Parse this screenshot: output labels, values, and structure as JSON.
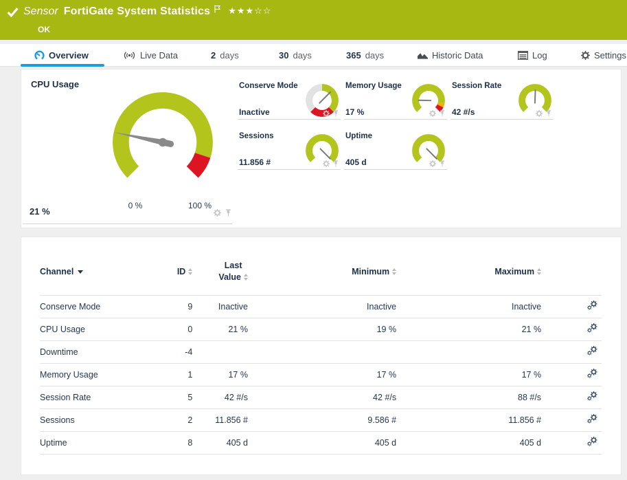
{
  "header": {
    "sensor_label": "Sensor",
    "title": "FortiGate System Statistics",
    "status": "OK",
    "stars": "★★★☆☆",
    "priority_stars_filled": 3,
    "priority_stars_total": 5
  },
  "tabs": [
    {
      "label": "Overview",
      "icon": "gauge-icon",
      "active": true
    },
    {
      "label": "Live Data",
      "icon": "live-data-icon",
      "active": false
    },
    {
      "prefix": "2",
      "suffix": "days",
      "active": false
    },
    {
      "prefix": "30",
      "suffix": "days",
      "active": false
    },
    {
      "prefix": "365",
      "suffix": "days",
      "active": false
    },
    {
      "label": "Historic Data",
      "icon": "historic-data-icon",
      "active": false
    },
    {
      "label": "Log",
      "icon": "log-icon",
      "active": false
    },
    {
      "label": "Settings",
      "icon": "gear-icon",
      "active": false
    }
  ],
  "gauges": {
    "cpu": {
      "title": "CPU Usage",
      "value": "21 %",
      "min_label": "0 %",
      "max_label": "100 %"
    },
    "mini": [
      {
        "title": "Conserve Mode",
        "value": "Inactive"
      },
      {
        "title": "Memory Usage",
        "value": "17 %"
      },
      {
        "title": "Session Rate",
        "value": "42 #/s"
      },
      {
        "title": "Sessions",
        "value": "11.856 #"
      },
      {
        "title": "Uptime",
        "value": "405 d"
      }
    ]
  },
  "chart_data": [
    {
      "type": "gauge",
      "title": "CPU Usage",
      "value": 21,
      "unit": "%",
      "min": 0,
      "max": 100,
      "segments": [
        {
          "from": 0,
          "to": 90,
          "color": "#b3c41c"
        },
        {
          "from": 90,
          "to": 100,
          "color": "#dd1522"
        }
      ]
    },
    {
      "type": "gauge",
      "title": "Conserve Mode",
      "value": "Inactive"
    },
    {
      "type": "gauge",
      "title": "Memory Usage",
      "value": 17,
      "unit": "%"
    },
    {
      "type": "gauge",
      "title": "Session Rate",
      "value": 42,
      "unit": "#/s"
    },
    {
      "type": "gauge",
      "title": "Sessions",
      "value": 11856,
      "unit": "#"
    },
    {
      "type": "gauge",
      "title": "Uptime",
      "value": 405,
      "unit": "d"
    }
  ],
  "table": {
    "header": {
      "channel": "Channel",
      "id": "ID",
      "last1": "Last",
      "last2": "Value",
      "min": "Minimum",
      "max": "Maximum"
    },
    "rows": [
      {
        "channel": "Conserve Mode",
        "id": "9",
        "last": "Inactive",
        "min": "Inactive",
        "max": "Inactive"
      },
      {
        "channel": "CPU Usage",
        "id": "0",
        "last": "21 %",
        "min": "19 %",
        "max": "21 %"
      },
      {
        "channel": "Downtime",
        "id": "-4",
        "last": "",
        "min": "",
        "max": ""
      },
      {
        "channel": "Memory Usage",
        "id": "1",
        "last": "17 %",
        "min": "17 %",
        "max": "17 %"
      },
      {
        "channel": "Session Rate",
        "id": "5",
        "last": "42 #/s",
        "min": "42 #/s",
        "max": "88 #/s"
      },
      {
        "channel": "Sessions",
        "id": "2",
        "last": "11.856 #",
        "min": "9.586 #",
        "max": "11.856 #"
      },
      {
        "channel": "Uptime",
        "id": "8",
        "last": "405 d",
        "min": "405 d",
        "max": "405 d"
      }
    ]
  },
  "colors": {
    "header_green": "#a7b812",
    "gauge_green": "#b3c41c",
    "gauge_red": "#dd1522",
    "gauge_yellow": "#f0b400",
    "gauge_gray": "#e2e2e2",
    "accent_blue": "#1d9cd8",
    "text_navy": "#233249"
  }
}
